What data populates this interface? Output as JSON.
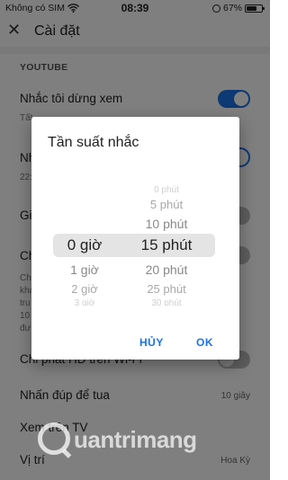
{
  "status_bar": {
    "carrier": "Không có SIM",
    "time": "08:39",
    "battery_percent": "67%",
    "battery_level": 0.67,
    "wifi_icon": "wifi-icon",
    "rotation_lock_icon": "rotation-lock-icon"
  },
  "app_bar": {
    "close_icon": "close-icon",
    "title": "Cài đặt"
  },
  "settings": {
    "section_header": "YOUTUBE",
    "rows": [
      {
        "title": "Nhắc tôi dừng xem",
        "subtitle": "Tất",
        "toggle": "on"
      },
      {
        "title": "Nh",
        "subtitle": "22:",
        "toggle": "outline"
      },
      {
        "title": "Gi",
        "toggle": "off"
      },
      {
        "title": "Ch",
        "subtitle_lines": [
          "Ch",
          "kha",
          "tru",
          "10",
          "đư"
        ],
        "toggle": "off"
      },
      {
        "title": "Chỉ phát HD trên Wi-Fi",
        "toggle": "off"
      },
      {
        "title": "Nhấn đúp để tua",
        "value": "10 giây"
      },
      {
        "title": "Xem trên TV"
      },
      {
        "title": "Vị trí",
        "value": "Hoa Kỳ"
      }
    ]
  },
  "dialog": {
    "title": "Tần suất nhắc",
    "hours": [
      {
        "label": "0 giờ",
        "selected": true
      },
      {
        "label": "1 giờ"
      },
      {
        "label": "2 giờ"
      },
      {
        "label": "3 giờ"
      }
    ],
    "minutes": [
      {
        "label": "0 phút"
      },
      {
        "label": "5 phút"
      },
      {
        "label": "10 phút"
      },
      {
        "label": "15 phút",
        "selected": true
      },
      {
        "label": "20 phút"
      },
      {
        "label": "25 phút"
      },
      {
        "label": "30 phút"
      }
    ],
    "cancel_label": "HỦY",
    "ok_label": "OK",
    "accent_color": "#1a73e8"
  },
  "watermark": {
    "text": "uantrimang"
  }
}
